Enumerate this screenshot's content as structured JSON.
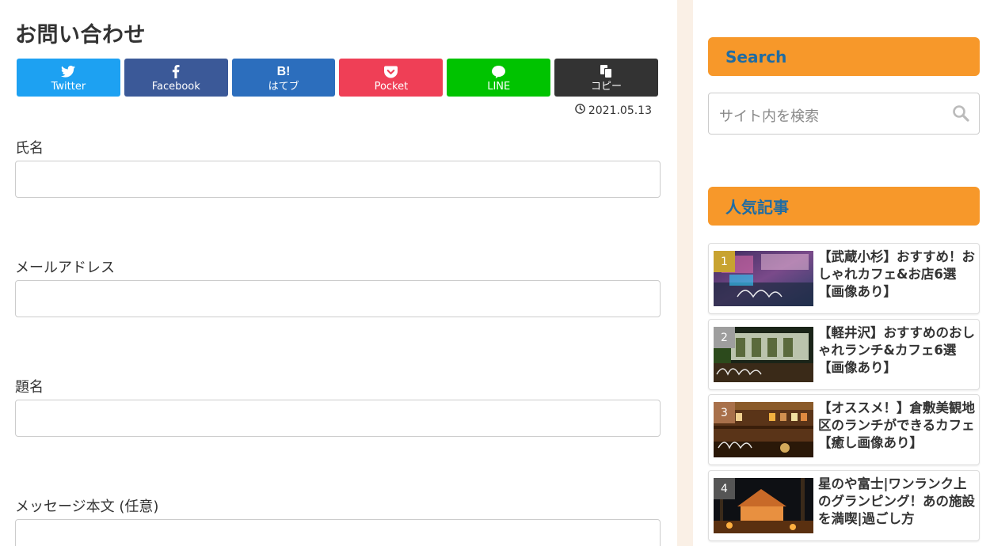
{
  "main": {
    "title": "お問い合わせ",
    "share": [
      {
        "label": "Twitter",
        "color": "#1da1f2",
        "icon": "twitter-icon"
      },
      {
        "label": "Facebook",
        "color": "#3b5998",
        "icon": "facebook-icon"
      },
      {
        "label": "はてブ",
        "color": "#2c6ebd",
        "icon": "hatena-icon",
        "glyph": "B!"
      },
      {
        "label": "Pocket",
        "color": "#ef3f56",
        "icon": "pocket-icon"
      },
      {
        "label": "LINE",
        "color": "#00c300",
        "icon": "line-icon",
        "glyph": "LINE"
      },
      {
        "label": "コピー",
        "color": "#333333",
        "icon": "copy-icon"
      }
    ],
    "date": "2021.05.13",
    "form": {
      "name_label": "氏名",
      "email_label": "メールアドレス",
      "subject_label": "題名",
      "message_label": "メッセージ本文 (任意)"
    }
  },
  "sidebar": {
    "search_heading": "Search",
    "search_placeholder": "サイト内を検索",
    "popular_heading": "人気記事",
    "popular": [
      {
        "rank": "1",
        "title": "【武蔵小杉】おすすめ！おしゃれカフェ&お店6選【画像あり】",
        "rank_color": "#c8a330",
        "overlay": "cafe"
      },
      {
        "rank": "2",
        "title": "【軽井沢】おすすめのおしゃれランチ&カフェ6選【画像あり】",
        "rank_color": "#9e9e9e",
        "overlay": "lunch"
      },
      {
        "rank": "3",
        "title": "【オススメ！】倉敷美観地区のランチができるカフェ【癒し画像あり】",
        "rank_color": "#a8704a",
        "overlay": "cafe"
      },
      {
        "rank": "4",
        "title": "星のや富士|ワンランク上のグランピング！あの施設を満喫|過ごし方",
        "rank_color": "#555555",
        "overlay": ""
      }
    ]
  },
  "colors": {
    "accent": "#f7982a",
    "heading_text": "#1f6ca3"
  }
}
